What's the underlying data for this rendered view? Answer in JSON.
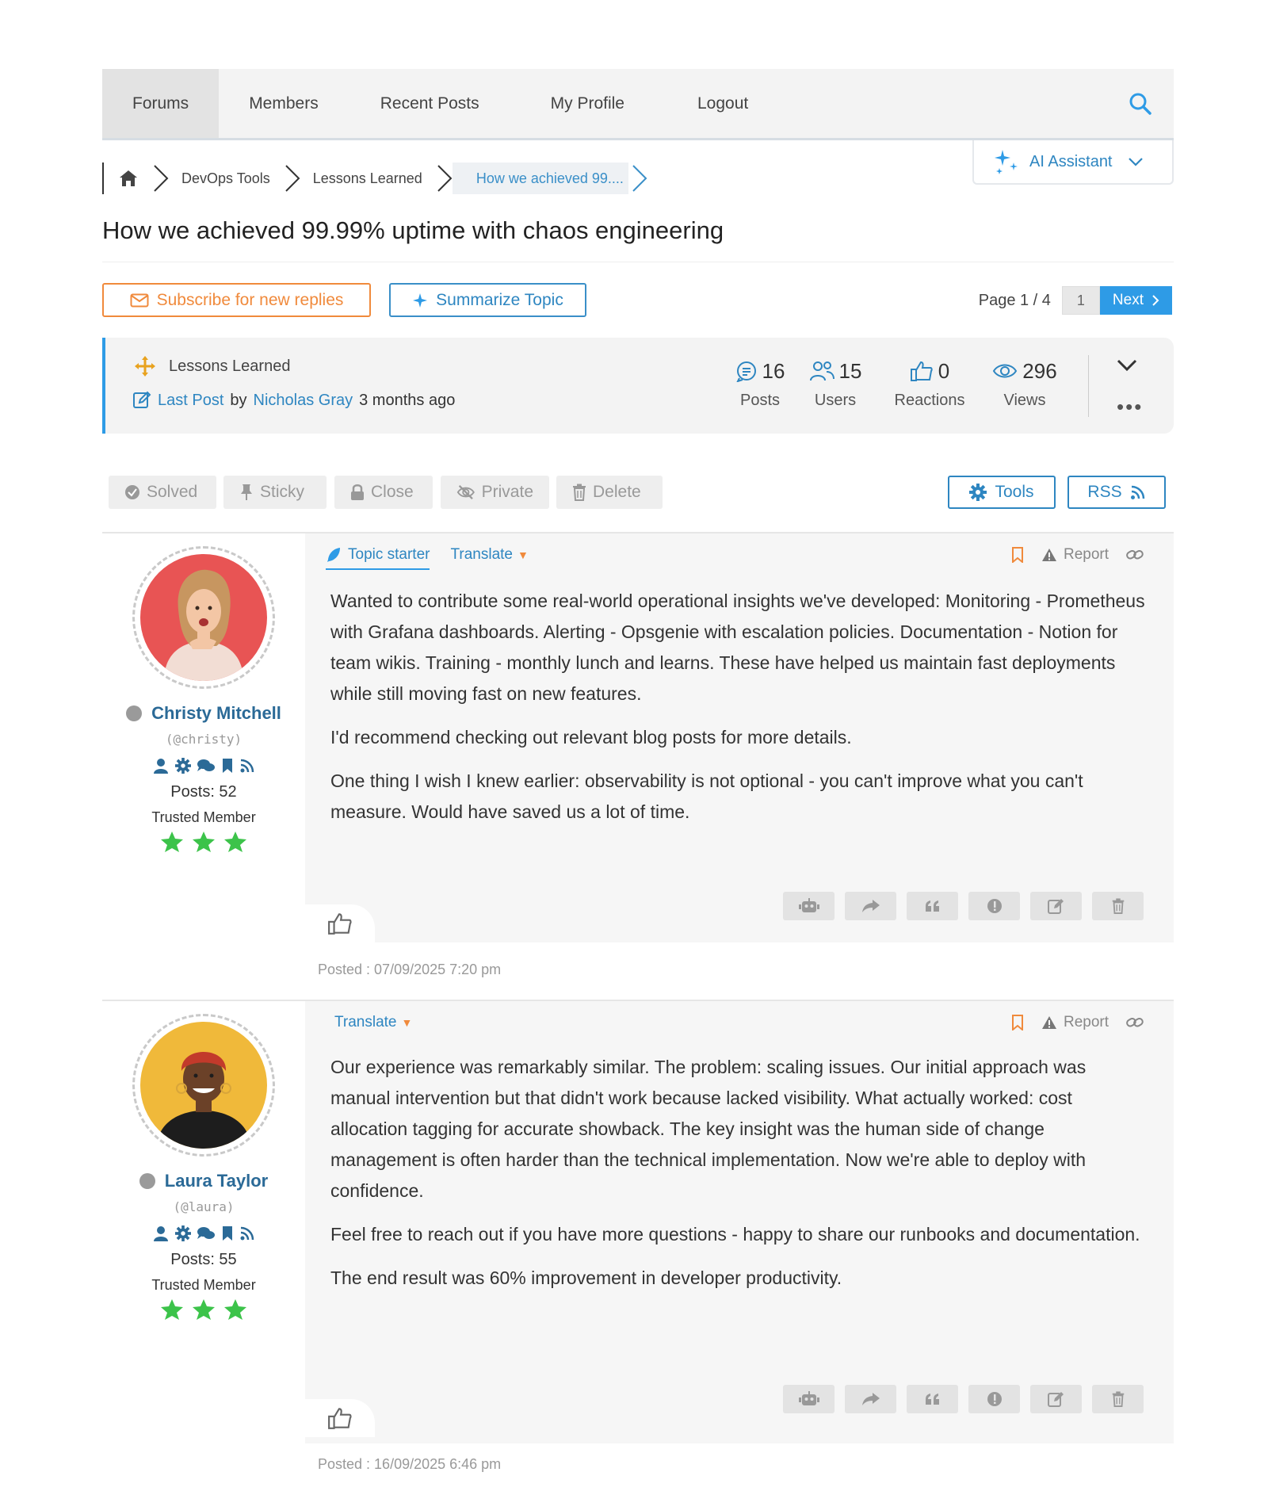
{
  "nav": {
    "items": [
      "Forums",
      "Members",
      "Recent Posts",
      "My Profile",
      "Logout"
    ],
    "active": "Forums"
  },
  "breadcrumb": {
    "items": [
      "DevOps Tools",
      "Lessons Learned",
      "How we achieved 99...."
    ]
  },
  "ai_assistant": {
    "label": "AI Assistant"
  },
  "topic": {
    "title": "How we achieved 99.99% uptime with chaos engineering"
  },
  "actions": {
    "subscribe_label": "Subscribe for new replies",
    "summarize_label": "Summarize Topic"
  },
  "pager": {
    "label": "Page 1 / 4",
    "current": "1",
    "next_label": "Next"
  },
  "info": {
    "forum": "Lessons Learned",
    "last_post_label": "Last Post",
    "by": "by",
    "last_author": "Nicholas Gray",
    "last_time": "3 months ago",
    "stats": [
      {
        "value": "16",
        "label": "Posts"
      },
      {
        "value": "15",
        "label": "Users"
      },
      {
        "value": "0",
        "label": "Reactions"
      },
      {
        "value": "296",
        "label": "Views"
      }
    ]
  },
  "moderation": {
    "solved": "Solved",
    "sticky": "Sticky",
    "close": "Close",
    "private": "Private",
    "delete": "Delete",
    "tools": "Tools",
    "rss": "RSS"
  },
  "posts": [
    {
      "author": "Christy Mitchell",
      "handle": "(@christy)",
      "posts_count": "Posts: 52",
      "rank": "Trusted Member",
      "starter_label": "Topic starter",
      "translate_label": "Translate",
      "report_label": "Report",
      "paragraphs": [
        "Wanted to contribute some real-world operational insights we've developed: Monitoring - Prometheus with Grafana dashboards. Alerting - Opsgenie with escalation policies. Documentation - Notion for team wikis. Training - monthly lunch and learns. These have helped us maintain fast deployments while still moving fast on new features.",
        "I'd recommend checking out relevant blog posts for more details.",
        "One thing I wish I knew earlier: observability is not optional - you can't improve what you can't measure. Would have saved us a lot of time."
      ],
      "posted": "Posted : 07/09/2025 7:20 pm",
      "avatar_bg": "#e85454"
    },
    {
      "author": "Laura Taylor",
      "handle": "(@laura)",
      "posts_count": "Posts: 55",
      "rank": "Trusted Member",
      "translate_label": "Translate",
      "report_label": "Report",
      "paragraphs": [
        "Our experience was remarkably similar. The problem: scaling issues. Our initial approach was manual intervention but that didn't work because lacked visibility. What actually worked: cost allocation tagging for accurate showback. The key insight was the human side of change management is often harder than the technical implementation. Now we're able to deploy with confidence.",
        "Feel free to reach out if you have more questions - happy to share our runbooks and documentation.",
        "The end result was 60% improvement in developer productivity."
      ],
      "posted": "Posted : 16/09/2025 6:46 pm",
      "avatar_bg": "#f0b93a"
    }
  ],
  "colors": {
    "accent": "#2e86c1",
    "orange": "#f08a3c",
    "star": "#3cc34a"
  }
}
